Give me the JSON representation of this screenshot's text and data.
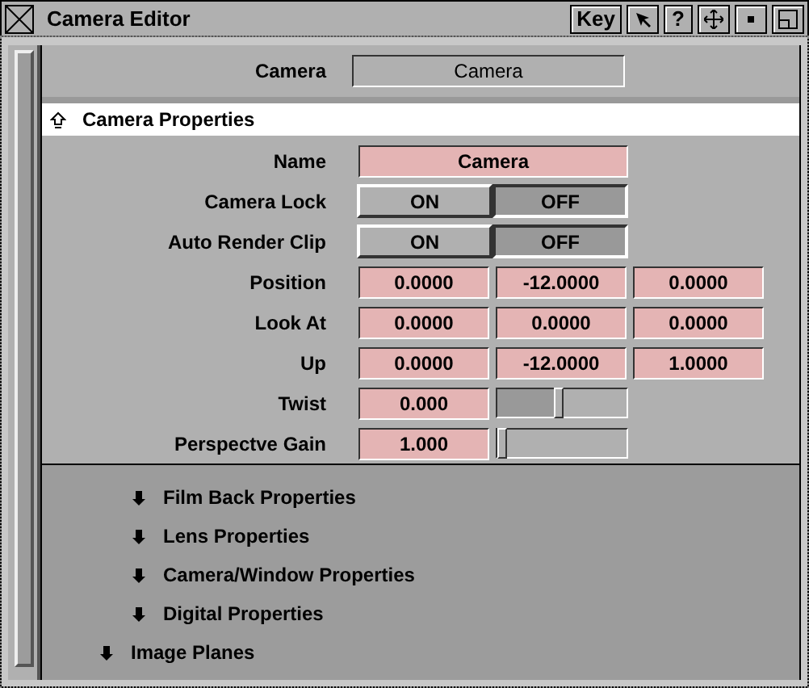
{
  "window": {
    "title": "Camera Editor",
    "buttons": [
      {
        "kind": "text",
        "label": "Key"
      },
      {
        "kind": "pointer"
      },
      {
        "kind": "text",
        "label": "?"
      },
      {
        "kind": "move"
      },
      {
        "kind": "dot"
      },
      {
        "kind": "maximize"
      }
    ]
  },
  "camera_selector": {
    "label": "Camera",
    "value": "Camera"
  },
  "sections": [
    {
      "title": "Camera Properties",
      "expanded": true,
      "fields": [
        {
          "kind": "text",
          "label": "Name",
          "value": "Camera"
        },
        {
          "kind": "toggle",
          "label": "Camera Lock",
          "options": [
            {
              "label": "ON",
              "selected": false
            },
            {
              "label": "OFF",
              "selected": true
            }
          ]
        },
        {
          "kind": "toggle",
          "label": "Auto Render Clip",
          "options": [
            {
              "label": "ON",
              "selected": false
            },
            {
              "label": "OFF",
              "selected": true
            }
          ]
        },
        {
          "kind": "vector",
          "label": "Position",
          "values": [
            "0.0000",
            "-12.0000",
            "0.0000"
          ]
        },
        {
          "kind": "vector",
          "label": "Look At",
          "values": [
            "0.0000",
            "0.0000",
            "0.0000"
          ]
        },
        {
          "kind": "vector",
          "label": "Up",
          "values": [
            "0.0000",
            "-12.0000",
            "1.0000"
          ]
        },
        {
          "kind": "slider",
          "label": "Twist",
          "value": "0.000",
          "level": 0.47
        },
        {
          "kind": "slider",
          "label": "Perspectve Gain",
          "value": "1.000",
          "level": 0.02
        }
      ],
      "children": [
        {
          "title": "Film Back Properties",
          "expanded": false
        },
        {
          "title": "Lens Properties",
          "expanded": false
        },
        {
          "title": "Camera/Window Properties",
          "expanded": false
        },
        {
          "title": "Digital Properties",
          "expanded": false
        }
      ]
    },
    {
      "title": "Image Planes",
      "expanded": false
    }
  ]
}
